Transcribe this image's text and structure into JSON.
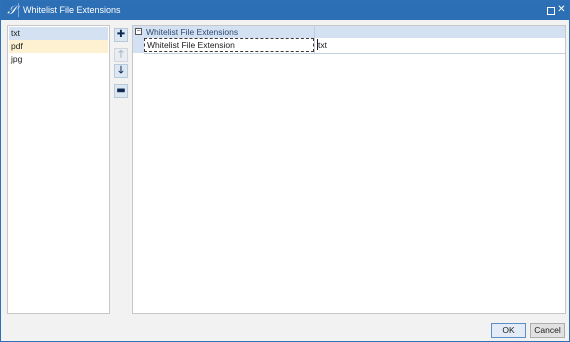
{
  "window": {
    "title": "Whitelist File Extensions",
    "app_icon_glyph": "𝒮",
    "close_glyph": "✕"
  },
  "extensions": {
    "items": [
      "txt",
      "pdf",
      "jpg"
    ],
    "selected_index": 0,
    "hover_index": 1
  },
  "toolbar": {
    "add_icon": "plus-icon",
    "add_glyph": "✚",
    "move_up_icon": "arrow-up-icon",
    "move_up_glyph": "🡑",
    "move_down_icon": "arrow-down-icon",
    "move_down_glyph": "🡓",
    "remove_icon": "minus-icon",
    "remove_glyph": "▬"
  },
  "property_grid": {
    "category_label": "Whitelist File Extensions",
    "collapse_glyph": "−",
    "property_name": "Whitelist File Extension",
    "property_value": "txt"
  },
  "buttons": {
    "ok_label": "OK",
    "cancel_label": "Cancel"
  },
  "colors": {
    "titlebar": "#2d6fb4",
    "selection": "#d3e1f2",
    "hover": "#fdf1d1"
  }
}
